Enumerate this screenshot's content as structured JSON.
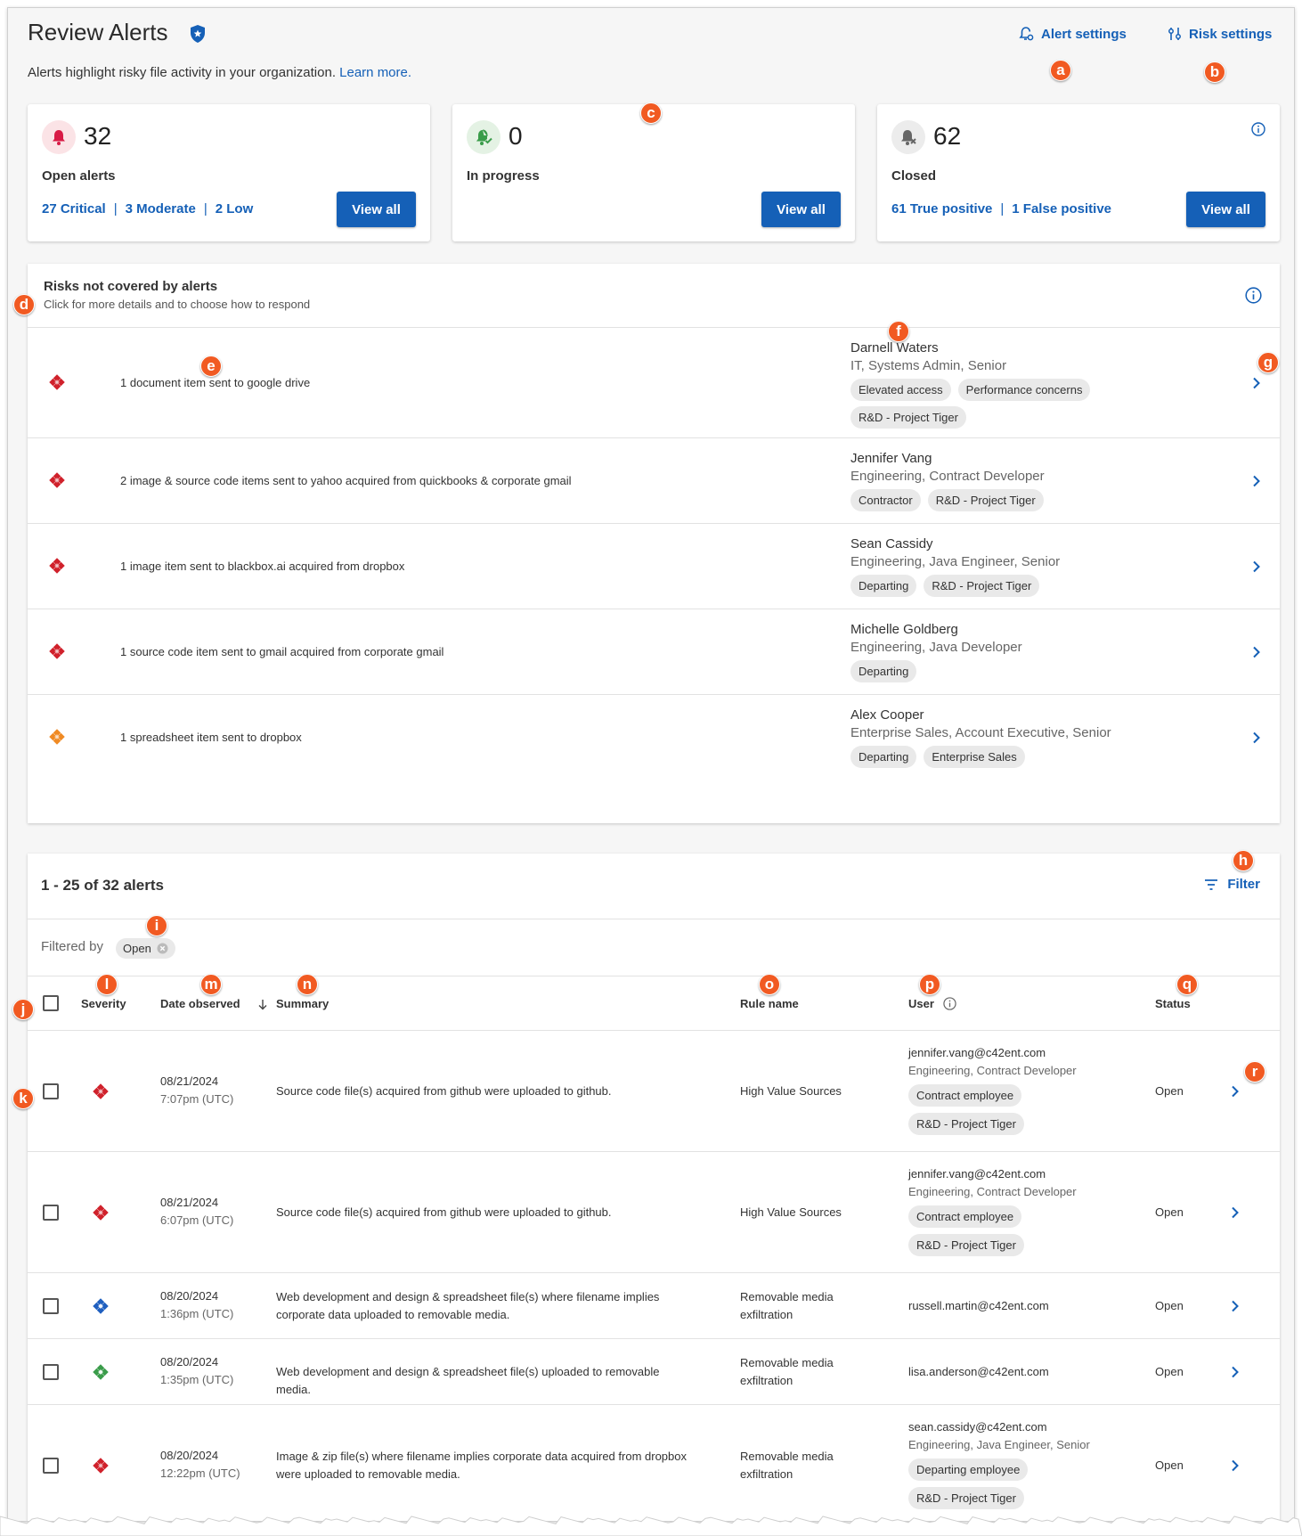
{
  "header": {
    "title": "Review Alerts",
    "subtitle": "Alerts highlight risky file activity in your organization.",
    "learn_more": "Learn more.",
    "alert_settings": "Alert settings",
    "risk_settings": "Risk settings"
  },
  "cards": [
    {
      "count": "32",
      "label": "Open alerts",
      "links": [
        "27 Critical",
        "3 Moderate",
        "2 Low"
      ],
      "button": "View all"
    },
    {
      "count": "0",
      "label": "In progress",
      "links": [],
      "button": "View all"
    },
    {
      "count": "62",
      "label": "Closed",
      "links": [
        "61 True positive",
        "1 False positive"
      ],
      "button": "View all"
    }
  ],
  "risks": {
    "title": "Risks not covered by alerts",
    "subtitle": "Click for more details and to choose how to respond",
    "rows": [
      {
        "severity": "critical",
        "description": "1 document item sent to google drive",
        "user": "Darnell Waters",
        "role": "IT, Systems Admin, Senior",
        "tags": [
          "Elevated access",
          "Performance concerns",
          "R&D - Project Tiger"
        ]
      },
      {
        "severity": "critical",
        "description": "2 image & source code items sent to yahoo acquired from quickbooks & corporate gmail",
        "user": "Jennifer Vang",
        "role": "Engineering, Contract Developer",
        "tags": [
          "Contractor",
          "R&D - Project Tiger"
        ]
      },
      {
        "severity": "critical",
        "description": "1 image item sent to blackbox.ai acquired from dropbox",
        "user": "Sean Cassidy",
        "role": "Engineering, Java Engineer, Senior",
        "tags": [
          "Departing",
          "R&D - Project Tiger"
        ]
      },
      {
        "severity": "critical",
        "description": "1 source code item sent to gmail acquired from corporate gmail",
        "user": "Michelle Goldberg",
        "role": "Engineering, Java Developer",
        "tags": [
          "Departing"
        ]
      },
      {
        "severity": "moderate",
        "description": "1 spreadsheet item sent to dropbox",
        "user": "Alex Cooper",
        "role": "Enterprise Sales, Account Executive, Senior",
        "tags": [
          "Departing",
          "Enterprise Sales"
        ]
      }
    ]
  },
  "alerts": {
    "count_label": "1 - 25 of 32 alerts",
    "filter_label": "Filter",
    "filtered_by": "Filtered by",
    "filter_chip": "Open",
    "columns": {
      "severity": "Severity",
      "date": "Date observed",
      "summary": "Summary",
      "rule": "Rule name",
      "user": "User",
      "status": "Status"
    },
    "rows": [
      {
        "severity": "critical",
        "date": "08/21/2024",
        "time": "7:07pm (UTC)",
        "summary": "Source code file(s) acquired from github were uploaded to github.",
        "rule": "High Value Sources",
        "email": "jennifer.vang@c42ent.com",
        "role": "Engineering, Contract Developer",
        "tags": [
          "Contract employee",
          "R&D - Project Tiger"
        ],
        "status": "Open"
      },
      {
        "severity": "critical",
        "date": "08/21/2024",
        "time": "6:07pm (UTC)",
        "summary": "Source code file(s) acquired from github were uploaded to github.",
        "rule": "High Value Sources",
        "email": "jennifer.vang@c42ent.com",
        "role": "Engineering, Contract Developer",
        "tags": [
          "Contract employee",
          "R&D - Project Tiger"
        ],
        "status": "Open"
      },
      {
        "severity": "low-blue",
        "date": "08/20/2024",
        "time": "1:36pm (UTC)",
        "summary": "Web development and design & spreadsheet file(s) where filename implies corporate data uploaded to removable media.",
        "rule": "Removable media exfiltration",
        "email": "russell.martin@c42ent.com",
        "role": "",
        "tags": [],
        "status": "Open"
      },
      {
        "severity": "low-green",
        "date": "08/20/2024",
        "time": "1:35pm (UTC)",
        "summary": "Web development and design & spreadsheet file(s) uploaded to removable media.",
        "rule": "Removable media exfiltration",
        "email": "lisa.anderson@c42ent.com",
        "role": "",
        "tags": [],
        "status": "Open"
      },
      {
        "severity": "critical",
        "date": "08/20/2024",
        "time": "12:22pm (UTC)",
        "summary": "Image & zip file(s) where filename implies corporate data acquired from dropbox were uploaded to removable media.",
        "rule": "Removable media exfiltration",
        "email": "sean.cassidy@c42ent.com",
        "role": "Engineering, Java Engineer, Senior",
        "tags": [
          "Departing employee",
          "R&D - Project Tiger"
        ],
        "status": "Open"
      }
    ]
  },
  "markers": [
    "a",
    "b",
    "c",
    "d",
    "e",
    "f",
    "g",
    "h",
    "i",
    "j",
    "k",
    "l",
    "m",
    "n",
    "o",
    "p",
    "q",
    "r"
  ],
  "colors": {
    "accent": "#1560b7",
    "critical": "#d0212b",
    "moderate": "#f08a24",
    "low_blue": "#1f5fbf",
    "low_green": "#3a9c4a",
    "marker": "#f15a22"
  }
}
